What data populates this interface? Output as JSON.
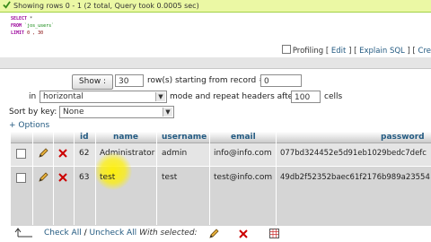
{
  "status": {
    "message": "Showing rows 0 - 1 (2 total, Query took 0.0005 sec)"
  },
  "sql": {
    "line1": [
      "SELECT",
      " *"
    ],
    "line2": [
      "FROM",
      " `jos_users`"
    ],
    "line3": [
      "LIMIT",
      " 0 , 30"
    ]
  },
  "sql_links": {
    "profiling": "Profiling",
    "edit": "Edit",
    "explain": "Explain SQL",
    "create": "Cre",
    "sep_open": "[",
    "sep_close": "]",
    "sep_mid": "] ["
  },
  "nav": {
    "show_label": "Show :",
    "show_count": "30",
    "rows_text": "row(s) starting from record #",
    "start_record": "0",
    "in_label": "in",
    "mode": "horizontal",
    "mode_text": "mode and repeat headers after",
    "repeat_headers": "100",
    "cells_text": "cells",
    "sort_label": "Sort by key:",
    "sort_value": "None",
    "options_label": "+ Options"
  },
  "table": {
    "columns": [
      "id",
      "name",
      "username",
      "email",
      "password"
    ],
    "rows": [
      {
        "id": "62",
        "name": "Administrator",
        "username": "admin",
        "email": "info@info.com",
        "password": "077bd324452e5d91eb1029bedc7defc"
      },
      {
        "id": "63",
        "name": "test",
        "username": "test",
        "email": "test@info.com",
        "password": "49db2f52352baec61f2176b989a23554"
      }
    ]
  },
  "footer": {
    "check_all": "Check All",
    "separator": "/",
    "uncheck_all": "Uncheck All",
    "with_selected": "With selected:"
  },
  "colors": {
    "success_bg": "#ebf8a4",
    "header_text": "#235a81",
    "row_bg": "#e5e5e5",
    "delete_red": "#cc0000",
    "highlight": "#fff000"
  }
}
